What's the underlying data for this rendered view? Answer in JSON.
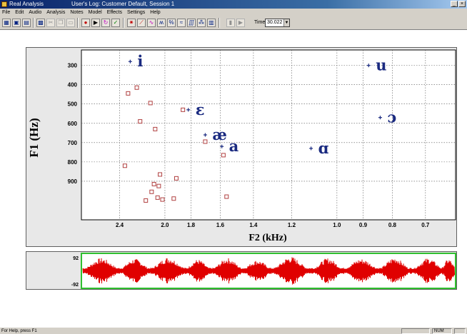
{
  "window": {
    "app_title": "Real Analysis",
    "user_log": "User's Log: Customer Default, Session 1",
    "minimize": "_",
    "close": "×"
  },
  "menu": [
    "File",
    "Edit",
    "Audio",
    "Analysis",
    "Notes",
    "Model",
    "Effects",
    "Settings",
    "Help"
  ],
  "toolbar": {
    "time_label": "Time",
    "time_value": "30.022"
  },
  "colors": {
    "vowel_text": "#1a2a80",
    "data_point": "#b04040",
    "waveform": "#e00000",
    "wave_border": "#30c030"
  },
  "chart_data": {
    "type": "scatter",
    "xlabel": "F2 (kHz)",
    "ylabel": "F1 (Hz)",
    "x_scale": "reversed-log",
    "x_ticks": [
      "2.4",
      "2.0",
      "1.8",
      "1.6",
      "1.4",
      "1.2",
      "1.0",
      "0.9",
      "0.8",
      "0.7"
    ],
    "y_ticks": [
      "300",
      "400",
      "500",
      "600",
      "700",
      "800",
      "900"
    ],
    "ylim": [
      220,
      1100
    ],
    "xlim": [
      2.8,
      0.62
    ],
    "grid": true,
    "reference_vowels": [
      {
        "symbol": "i",
        "f2": 2.3,
        "f1": 280
      },
      {
        "symbol": "ɛ",
        "f2": 1.82,
        "f1": 530
      },
      {
        "symbol": "æ",
        "f2": 1.7,
        "f1": 660
      },
      {
        "symbol": "a",
        "f2": 1.59,
        "f1": 720
      },
      {
        "symbol": "ɑ",
        "f2": 1.11,
        "f1": 730
      },
      {
        "symbol": "u",
        "f2": 0.88,
        "f1": 300
      },
      {
        "symbol": "ɔ",
        "f2": 0.84,
        "f1": 570
      }
    ],
    "measured_points": [
      {
        "f2": 2.24,
        "f1": 415
      },
      {
        "f2": 2.32,
        "f1": 445
      },
      {
        "f2": 2.12,
        "f1": 495
      },
      {
        "f2": 1.86,
        "f1": 530
      },
      {
        "f2": 2.21,
        "f1": 590
      },
      {
        "f2": 2.08,
        "f1": 630
      },
      {
        "f2": 1.7,
        "f1": 695
      },
      {
        "f2": 1.58,
        "f1": 765
      },
      {
        "f2": 2.35,
        "f1": 820
      },
      {
        "f2": 2.04,
        "f1": 865
      },
      {
        "f2": 1.91,
        "f1": 885
      },
      {
        "f2": 2.09,
        "f1": 915
      },
      {
        "f2": 2.05,
        "f1": 925
      },
      {
        "f2": 2.11,
        "f1": 955
      },
      {
        "f2": 2.06,
        "f1": 985
      },
      {
        "f2": 2.02,
        "f1": 995
      },
      {
        "f2": 1.93,
        "f1": 990
      },
      {
        "f2": 2.16,
        "f1": 1000
      },
      {
        "f2": 1.56,
        "f1": 980
      }
    ]
  },
  "waveform": {
    "top_label": "92",
    "bottom_label": "-92"
  },
  "status": {
    "help_text": "For Help, press F1",
    "num": "NUM"
  }
}
